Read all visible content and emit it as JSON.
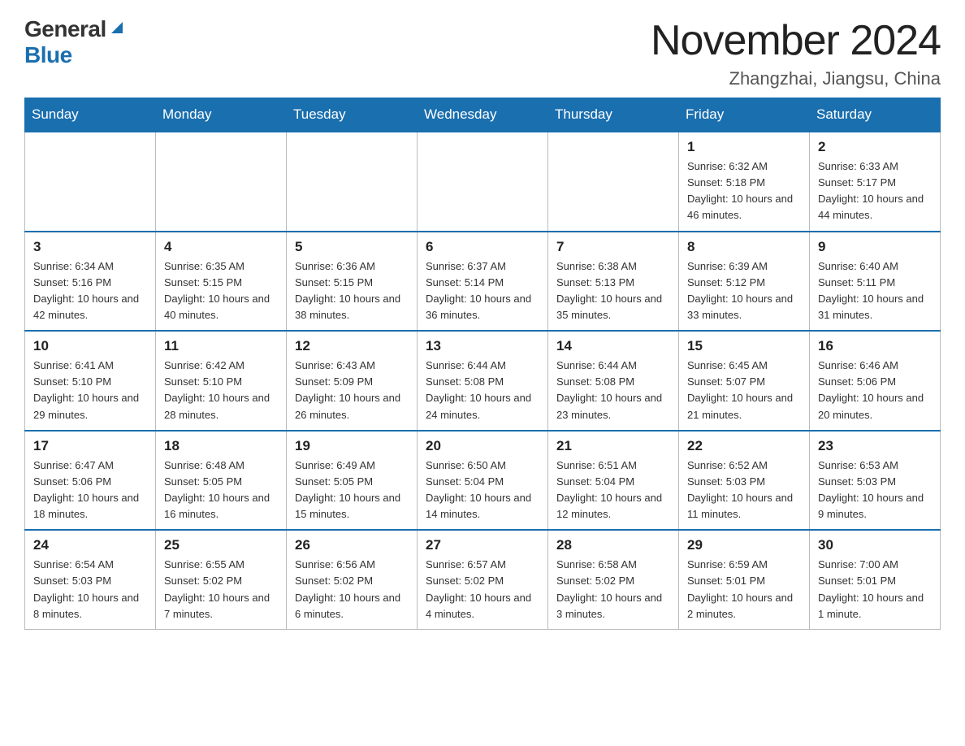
{
  "header": {
    "logo_general": "General",
    "logo_blue": "Blue",
    "title": "November 2024",
    "subtitle": "Zhangzhai, Jiangsu, China"
  },
  "days_of_week": [
    "Sunday",
    "Monday",
    "Tuesday",
    "Wednesday",
    "Thursday",
    "Friday",
    "Saturday"
  ],
  "weeks": [
    [
      {
        "day": "",
        "info": ""
      },
      {
        "day": "",
        "info": ""
      },
      {
        "day": "",
        "info": ""
      },
      {
        "day": "",
        "info": ""
      },
      {
        "day": "",
        "info": ""
      },
      {
        "day": "1",
        "info": "Sunrise: 6:32 AM\nSunset: 5:18 PM\nDaylight: 10 hours and 46 minutes."
      },
      {
        "day": "2",
        "info": "Sunrise: 6:33 AM\nSunset: 5:17 PM\nDaylight: 10 hours and 44 minutes."
      }
    ],
    [
      {
        "day": "3",
        "info": "Sunrise: 6:34 AM\nSunset: 5:16 PM\nDaylight: 10 hours and 42 minutes."
      },
      {
        "day": "4",
        "info": "Sunrise: 6:35 AM\nSunset: 5:15 PM\nDaylight: 10 hours and 40 minutes."
      },
      {
        "day": "5",
        "info": "Sunrise: 6:36 AM\nSunset: 5:15 PM\nDaylight: 10 hours and 38 minutes."
      },
      {
        "day": "6",
        "info": "Sunrise: 6:37 AM\nSunset: 5:14 PM\nDaylight: 10 hours and 36 minutes."
      },
      {
        "day": "7",
        "info": "Sunrise: 6:38 AM\nSunset: 5:13 PM\nDaylight: 10 hours and 35 minutes."
      },
      {
        "day": "8",
        "info": "Sunrise: 6:39 AM\nSunset: 5:12 PM\nDaylight: 10 hours and 33 minutes."
      },
      {
        "day": "9",
        "info": "Sunrise: 6:40 AM\nSunset: 5:11 PM\nDaylight: 10 hours and 31 minutes."
      }
    ],
    [
      {
        "day": "10",
        "info": "Sunrise: 6:41 AM\nSunset: 5:10 PM\nDaylight: 10 hours and 29 minutes."
      },
      {
        "day": "11",
        "info": "Sunrise: 6:42 AM\nSunset: 5:10 PM\nDaylight: 10 hours and 28 minutes."
      },
      {
        "day": "12",
        "info": "Sunrise: 6:43 AM\nSunset: 5:09 PM\nDaylight: 10 hours and 26 minutes."
      },
      {
        "day": "13",
        "info": "Sunrise: 6:44 AM\nSunset: 5:08 PM\nDaylight: 10 hours and 24 minutes."
      },
      {
        "day": "14",
        "info": "Sunrise: 6:44 AM\nSunset: 5:08 PM\nDaylight: 10 hours and 23 minutes."
      },
      {
        "day": "15",
        "info": "Sunrise: 6:45 AM\nSunset: 5:07 PM\nDaylight: 10 hours and 21 minutes."
      },
      {
        "day": "16",
        "info": "Sunrise: 6:46 AM\nSunset: 5:06 PM\nDaylight: 10 hours and 20 minutes."
      }
    ],
    [
      {
        "day": "17",
        "info": "Sunrise: 6:47 AM\nSunset: 5:06 PM\nDaylight: 10 hours and 18 minutes."
      },
      {
        "day": "18",
        "info": "Sunrise: 6:48 AM\nSunset: 5:05 PM\nDaylight: 10 hours and 16 minutes."
      },
      {
        "day": "19",
        "info": "Sunrise: 6:49 AM\nSunset: 5:05 PM\nDaylight: 10 hours and 15 minutes."
      },
      {
        "day": "20",
        "info": "Sunrise: 6:50 AM\nSunset: 5:04 PM\nDaylight: 10 hours and 14 minutes."
      },
      {
        "day": "21",
        "info": "Sunrise: 6:51 AM\nSunset: 5:04 PM\nDaylight: 10 hours and 12 minutes."
      },
      {
        "day": "22",
        "info": "Sunrise: 6:52 AM\nSunset: 5:03 PM\nDaylight: 10 hours and 11 minutes."
      },
      {
        "day": "23",
        "info": "Sunrise: 6:53 AM\nSunset: 5:03 PM\nDaylight: 10 hours and 9 minutes."
      }
    ],
    [
      {
        "day": "24",
        "info": "Sunrise: 6:54 AM\nSunset: 5:03 PM\nDaylight: 10 hours and 8 minutes."
      },
      {
        "day": "25",
        "info": "Sunrise: 6:55 AM\nSunset: 5:02 PM\nDaylight: 10 hours and 7 minutes."
      },
      {
        "day": "26",
        "info": "Sunrise: 6:56 AM\nSunset: 5:02 PM\nDaylight: 10 hours and 6 minutes."
      },
      {
        "day": "27",
        "info": "Sunrise: 6:57 AM\nSunset: 5:02 PM\nDaylight: 10 hours and 4 minutes."
      },
      {
        "day": "28",
        "info": "Sunrise: 6:58 AM\nSunset: 5:02 PM\nDaylight: 10 hours and 3 minutes."
      },
      {
        "day": "29",
        "info": "Sunrise: 6:59 AM\nSunset: 5:01 PM\nDaylight: 10 hours and 2 minutes."
      },
      {
        "day": "30",
        "info": "Sunrise: 7:00 AM\nSunset: 5:01 PM\nDaylight: 10 hours and 1 minute."
      }
    ]
  ]
}
